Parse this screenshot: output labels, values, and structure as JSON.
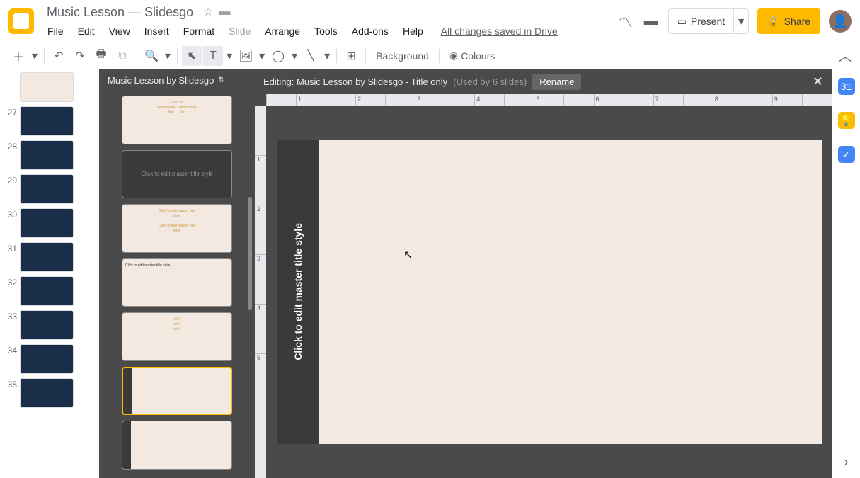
{
  "doc": {
    "title": "Music Lesson — Slidesgo"
  },
  "menu": {
    "file": "File",
    "edit": "Edit",
    "view": "View",
    "insert": "Insert",
    "format": "Format",
    "slide": "Slide",
    "arrange": "Arrange",
    "tools": "Tools",
    "addons": "Add-ons",
    "help": "Help",
    "save_status": "All changes saved in Drive"
  },
  "header_actions": {
    "present": "Present",
    "share": "Share"
  },
  "toolbar": {
    "background": "Background",
    "colours": "Colours"
  },
  "master": {
    "dropdown_title": "Music Lesson by Slidesgo",
    "editing_prefix": "Editing: ",
    "editing_title": "Music Lesson by Slidesgo - Title only",
    "used_by": "(Used by 6 slides)",
    "rename": "Rename"
  },
  "slide": {
    "placeholder": "Click to edit master title style"
  },
  "left_thumbs": [
    {
      "num": "",
      "variant": "light"
    },
    {
      "num": "27",
      "variant": "dark"
    },
    {
      "num": "28",
      "variant": "dark"
    },
    {
      "num": "29",
      "variant": "dark"
    },
    {
      "num": "30",
      "variant": "dark"
    },
    {
      "num": "31",
      "variant": "dark"
    },
    {
      "num": "32",
      "variant": "dark"
    },
    {
      "num": "33",
      "variant": "dark"
    },
    {
      "num": "34",
      "variant": "dark"
    },
    {
      "num": "35",
      "variant": "dark"
    }
  ],
  "master_thumbs": [
    {
      "text": "Click to edit master title style",
      "variant": "light-cols",
      "selected": false
    },
    {
      "text": "Click to edit master title style",
      "variant": "dark",
      "selected": false
    },
    {
      "text": "Click to edit master title style",
      "variant": "light-split",
      "selected": false
    },
    {
      "text": "Click to edit master title style",
      "variant": "light-list",
      "selected": false
    },
    {
      "text": "xx%",
      "variant": "light-pct",
      "selected": false
    },
    {
      "text": "",
      "variant": "title-only",
      "selected": true
    },
    {
      "text": "",
      "variant": "title-only",
      "selected": false
    }
  ],
  "ruler_h": [
    "",
    "1",
    "",
    "2",
    "",
    "3",
    "",
    "4",
    "",
    "5",
    "",
    "6",
    "",
    "7",
    "",
    "8",
    "",
    "9",
    ""
  ],
  "ruler_v": [
    "",
    "1",
    "2",
    "3",
    "4",
    "5"
  ]
}
